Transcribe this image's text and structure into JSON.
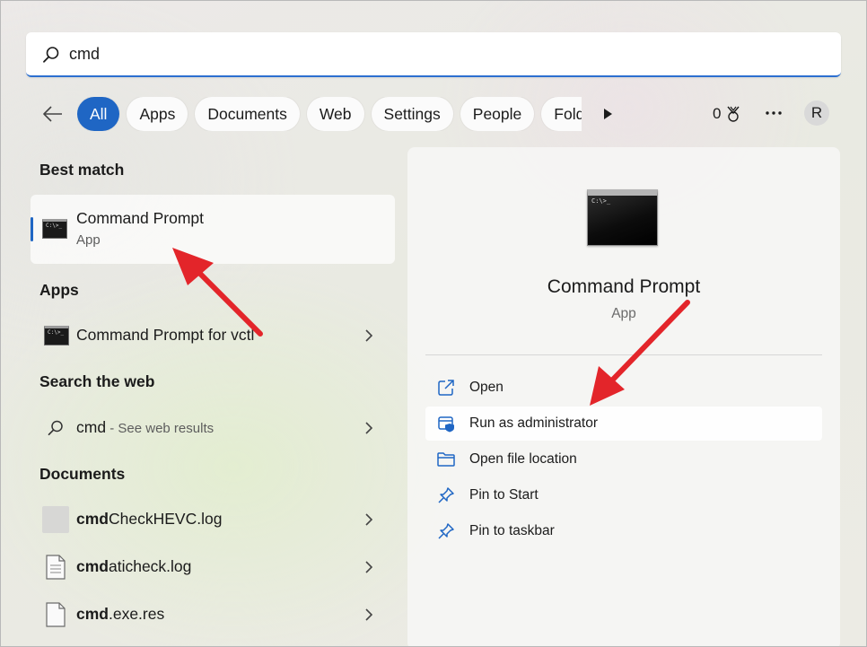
{
  "search": {
    "value": "cmd"
  },
  "filters": [
    "All",
    "Apps",
    "Documents",
    "Web",
    "Settings",
    "People",
    "Folde"
  ],
  "header": {
    "points": "0",
    "avatar_initial": "R"
  },
  "best_match": {
    "title": "Best match",
    "name": "Command Prompt",
    "type": "App"
  },
  "apps": {
    "title": "Apps",
    "items": [
      {
        "name": "Command Prompt for vctl"
      }
    ]
  },
  "web": {
    "title": "Search the web",
    "query": "cmd",
    "suffix": " - See web results"
  },
  "documents": {
    "title": "Documents",
    "items": [
      {
        "bold": "cmd",
        "rest": "CheckHEVC.log"
      },
      {
        "bold": "cmd",
        "rest": "aticheck.log"
      },
      {
        "bold": "cmd",
        "rest": ".exe.res"
      }
    ]
  },
  "panel": {
    "name": "Command Prompt",
    "type": "App",
    "actions": [
      {
        "label": "Open",
        "icon": "open-external-icon"
      },
      {
        "label": "Run as administrator",
        "icon": "shield-admin-icon"
      },
      {
        "label": "Open file location",
        "icon": "folder-icon"
      },
      {
        "label": "Pin to Start",
        "icon": "pin-icon"
      },
      {
        "label": "Pin to taskbar",
        "icon": "pin-icon"
      }
    ]
  },
  "colors": {
    "accent": "#1f66c4",
    "annotation": "#e3252a"
  },
  "cmd_icon_text": "C:\\>_"
}
